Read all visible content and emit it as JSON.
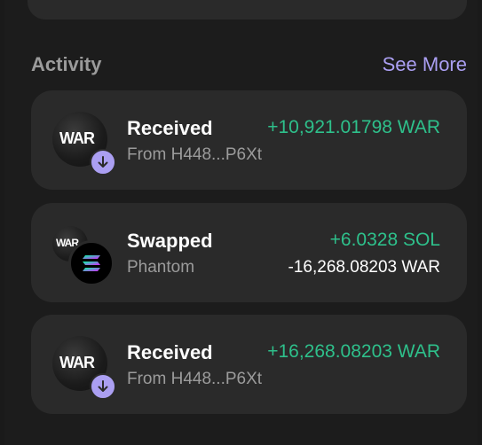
{
  "activity": {
    "title": "Activity",
    "see_more": "See More",
    "items": [
      {
        "type": "Received",
        "detail": "From H448...P6Xt",
        "amount": "+10,921.01798 WAR",
        "avatar_text": "WAR"
      },
      {
        "type": "Swapped",
        "detail": "Phantom",
        "amount": "+6.0328 SOL",
        "amount_secondary": "-16,268.08203 WAR",
        "avatar_text": "WAR"
      },
      {
        "type": "Received",
        "detail": "From H448...P6Xt",
        "amount": "+16,268.08203 WAR",
        "avatar_text": "WAR"
      }
    ]
  },
  "colors": {
    "accent": "#ab9ff2",
    "positive": "#2ec08b",
    "card": "#2a2a2a",
    "background": "#1c1c1c"
  },
  "icons": [
    "arrow-down-icon",
    "solana-icon",
    "war-token-icon"
  ]
}
